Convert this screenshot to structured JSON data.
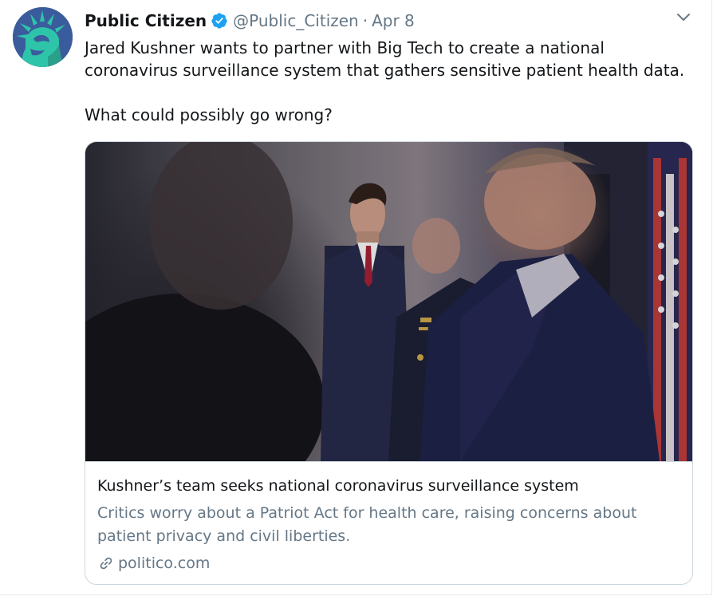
{
  "tweet": {
    "display_name": "Public Citizen",
    "handle": "@Public_Citizen",
    "separator": "·",
    "date": "Apr 8",
    "text_line1": "Jared Kushner wants to partner with Big Tech to create a national coronavirus surveillance system that gathers sensitive patient health data.",
    "text_line2": "What could possibly go wrong?"
  },
  "card": {
    "title": "Kushner’s team seeks national coronavirus surveillance system",
    "description": "Critics worry about a Patriot Act for health care, raising concerns about patient privacy and civil liberties.",
    "domain": "politico.com"
  },
  "icons": {
    "verified": "verified-badge-icon",
    "caret": "chevron-down-icon",
    "link": "link-icon"
  },
  "colors": {
    "accent": "#1da1f2",
    "secondary_text": "#657786",
    "avatar_bg": "#3a5a9a",
    "avatar_logo": "#2ec4a9"
  }
}
